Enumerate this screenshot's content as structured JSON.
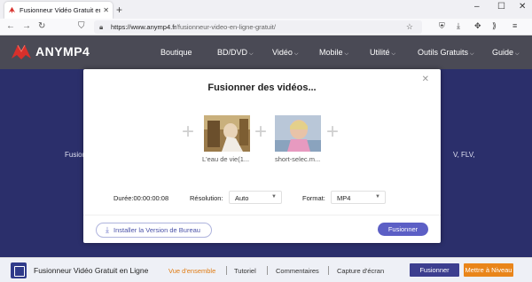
{
  "browser": {
    "tab_title": "Fusionneur Vidéo Gratuit en Lig",
    "tab_close": "✕",
    "new_tab": "+",
    "url_domain": "https://www.anymp4.fr",
    "url_path": "/fusionneur-video-en-ligne-gratuit/",
    "window_controls": [
      "–",
      "☐",
      "✕"
    ]
  },
  "site": {
    "brand": "ANYMP4",
    "nav": [
      {
        "label": "Boutique",
        "chevron": ""
      },
      {
        "label": "BD/DVD",
        "chevron": "⌵"
      },
      {
        "label": "Vidéo",
        "chevron": "⌵"
      },
      {
        "label": "Mobile",
        "chevron": "⌵"
      },
      {
        "label": "Utilité",
        "chevron": "⌵"
      },
      {
        "label": "Outils Gratuits",
        "chevron": "⌵"
      },
      {
        "label": "Guide",
        "chevron": "⌵"
      }
    ],
    "bg_left_text": "Fusion",
    "bg_right_text": "V, FLV,"
  },
  "modal": {
    "title": "Fusionner des vidéos...",
    "close": "✕",
    "add_symbol": "+",
    "videos": [
      {
        "caption": "L'eau de vie(1..."
      },
      {
        "caption": "short-selec.m..."
      }
    ],
    "duration_label": "Durée:00:00:00:08",
    "resolution_label": "Résolution:",
    "resolution_value": "Auto",
    "format_label": "Format:",
    "format_value": "MP4",
    "install_label": "Installer la Version de Bureau",
    "merge_label": "Fusionner"
  },
  "bottombar": {
    "app_name": "Fusionneur Vidéo Gratuit en Ligne",
    "links": [
      "Vue d'ensemble",
      "Tutoriel",
      "Commentaires",
      "Capture d'écran"
    ],
    "active_link": "Vue d'ensemble",
    "merge_label": "Fusionner",
    "upgrade_label": "Mettre à Niveau"
  },
  "colors": {
    "header_bg": "#4a4a55",
    "page_bg": "#2b2f6b",
    "merge_button": "#5c5fc5",
    "bottom_merge": "#3c3e8f",
    "upgrade_button": "#e9851a",
    "active_link": "#e07b12"
  },
  "icons": [
    "anymp4-favicon",
    "back-icon",
    "forward-icon",
    "reload-icon",
    "shield-icon",
    "lock-icon",
    "star-icon",
    "download-icon",
    "menu-icon",
    "puzzle-icon",
    "logo-icon",
    "app-icon"
  ]
}
